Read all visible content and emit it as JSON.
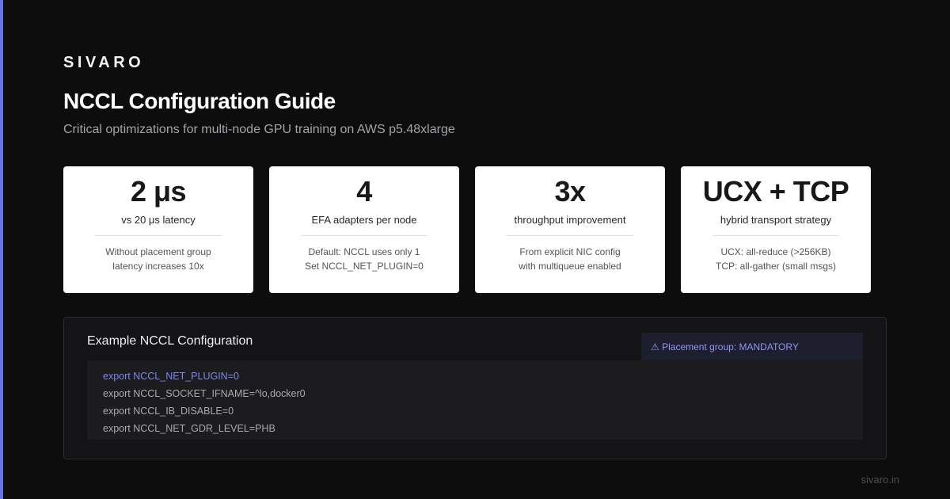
{
  "brand": "SIVARO",
  "title": "NCCL Configuration Guide",
  "subtitle": "Critical optimizations for multi-node GPU training on AWS p5.48xlarge",
  "cards": [
    {
      "value": "2 μs",
      "label": "vs 20 μs latency",
      "note_lines": [
        "Without placement group",
        "latency increases 10x"
      ]
    },
    {
      "value": "4",
      "label": "EFA adapters per node",
      "note_lines": [
        "Default: NCCL uses only 1",
        "Set NCCL_NET_PLUGIN=0"
      ]
    },
    {
      "value": "3x",
      "label": "throughput improvement",
      "note_lines": [
        "From explicit NIC config",
        "with multiqueue enabled"
      ]
    },
    {
      "value": "UCX + TCP",
      "label": "hybrid transport strategy",
      "note_lines": [
        "UCX: all-reduce (>256KB)",
        "TCP: all-gather (small msgs)"
      ]
    }
  ],
  "panel": {
    "title": "Example NCCL Configuration",
    "warning_icon": "warning-icon",
    "warning_symbol": "⚠",
    "warning_text": "Placement group: MANDATORY",
    "code_lines": [
      "export NCCL_NET_PLUGIN=0",
      "export NCCL_SOCKET_IFNAME=^lo,docker0",
      "export NCCL_IB_DISABLE=0",
      "export NCCL_NET_GDR_LEVEL=PHB"
    ]
  },
  "footer": "sivaro.in",
  "colors": {
    "accent": "#6b72e8",
    "background": "#0d0d0e",
    "card_background": "#ffffff",
    "highlight_code": "#7f86ee"
  }
}
